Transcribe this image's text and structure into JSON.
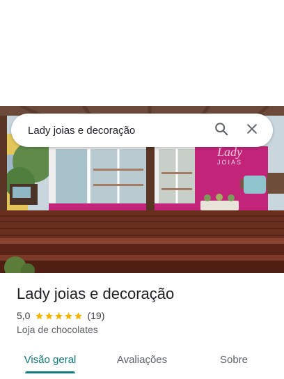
{
  "search": {
    "query": "Lady joias e decoração"
  },
  "hero": {
    "sign_logo": "Lady",
    "sign_text": "JOIAS"
  },
  "place": {
    "name": "Lady joias e decoração",
    "rating": "5,0",
    "stars": 5,
    "reviews": "(19)",
    "category": "Loja de chocolates"
  },
  "tabs": [
    {
      "label": "Visão geral",
      "active": true
    },
    {
      "label": "Avaliações",
      "active": false
    },
    {
      "label": "Sobre",
      "active": false
    }
  ],
  "colors": {
    "accent": "#0b7b7d",
    "star": "#f4b400",
    "storefront": "#c2247a"
  }
}
